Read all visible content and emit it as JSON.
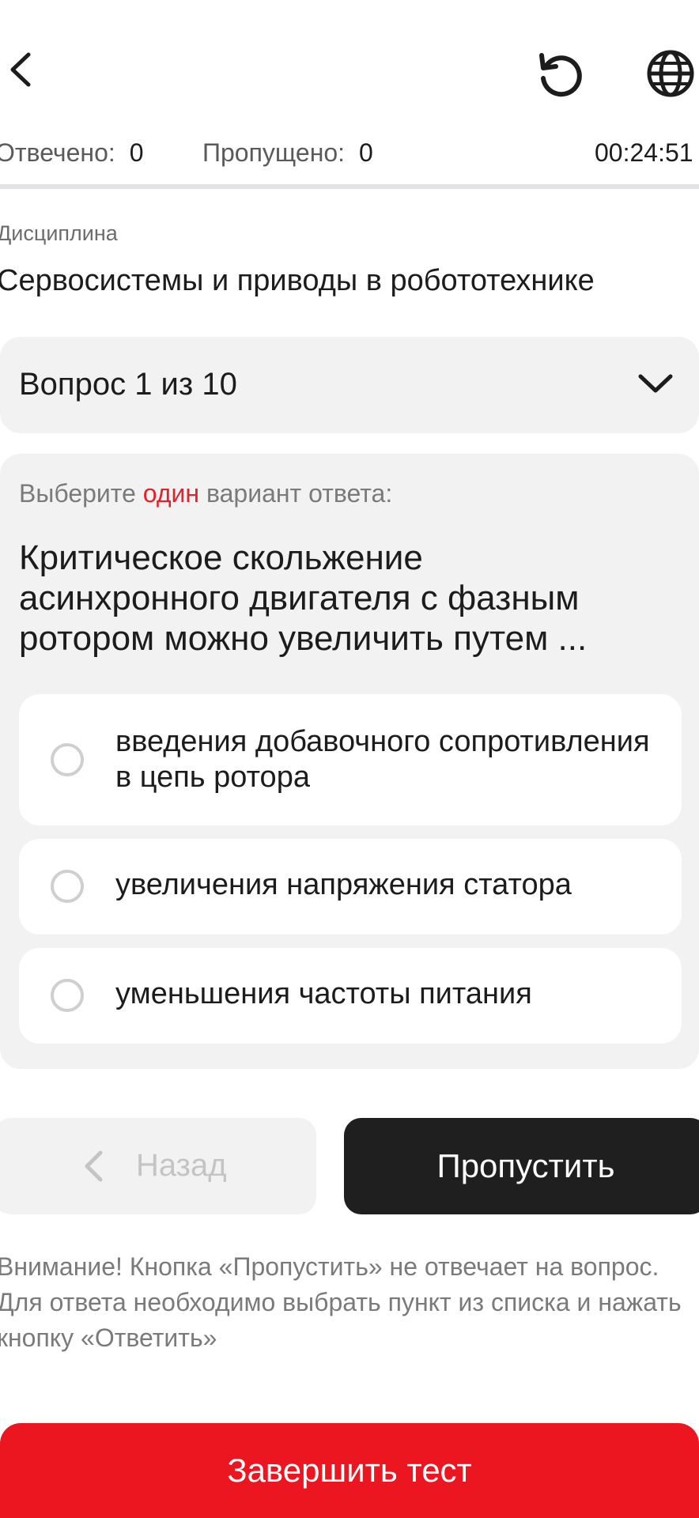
{
  "header": {
    "back_icon": "chevron-left-icon",
    "reload_icon": "reload-icon",
    "language_icon": "globe-icon"
  },
  "stats": {
    "answered_label": "Отвечено:",
    "answered_value": "0",
    "skipped_label": "Пропущено:",
    "skipped_value": "0",
    "timer": "00:24:51"
  },
  "discipline": {
    "caption": "Дисциплина",
    "title": "Сервосистемы и приводы в робототехнике"
  },
  "question_selector": {
    "label": "Вопрос 1 из 10",
    "icon": "chevron-down-icon"
  },
  "question": {
    "instruction_before": "Выберите ",
    "instruction_accent": "один",
    "instruction_after": " вариант ответа:",
    "text": "Критическое скольжение асинхронного двигателя с фазным ротором можно увеличить путем ...",
    "options": [
      {
        "label": "введения добавочного сопротивления в цепь ротора"
      },
      {
        "label": "увеличения напряжения статора"
      },
      {
        "label": "уменьшения частоты питания"
      }
    ]
  },
  "buttons": {
    "back_label": "Назад",
    "skip_label": "Пропустить",
    "finish_label": "Завершить тест"
  },
  "notice": "Внимание! Кнопка «Пропустить» не отвечает на вопрос. Для ответа необходимо выбрать пункт из списка и нажать кнопку «Ответить»",
  "colors": {
    "accent": "#e0242b",
    "finish_button": "#ec1620",
    "skip_button": "#1f1f1f"
  }
}
